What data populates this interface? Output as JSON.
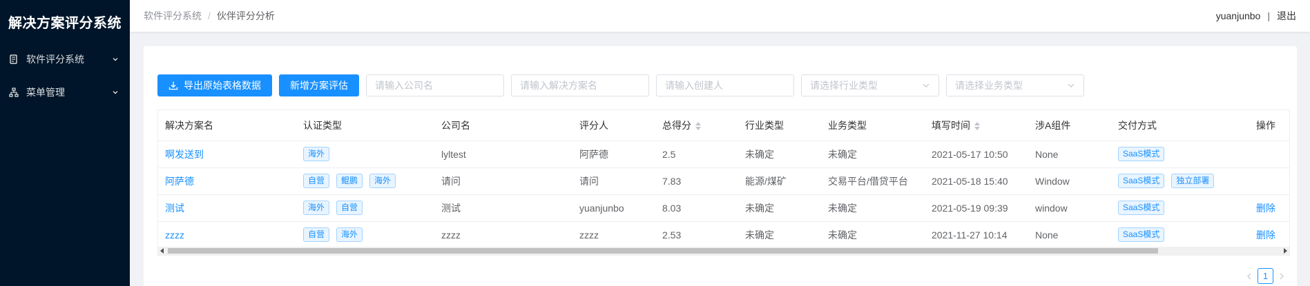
{
  "app": {
    "title": "解决方案评分系统"
  },
  "sidebar": {
    "items": [
      {
        "label": "软件评分系统",
        "icon": "document-icon"
      },
      {
        "label": "菜单管理",
        "icon": "sitemap-icon"
      }
    ]
  },
  "header": {
    "breadcrumb": [
      "软件评分系统",
      "伙伴评分分析"
    ],
    "separator": "/",
    "user": "yuanjunbo",
    "divider": "|",
    "logout": "退出"
  },
  "toolbar": {
    "export_label": "导出原始表格数据",
    "add_label": "新增方案评估",
    "company_placeholder": "请输入公司名",
    "solution_placeholder": "请输入解决方案名",
    "creator_placeholder": "请输入创建人",
    "industry_placeholder": "请选择行业类型",
    "business_placeholder": "请选择业务类型"
  },
  "table": {
    "columns": [
      "解决方案名",
      "认证类型",
      "公司名",
      "评分人",
      "总得分",
      "行业类型",
      "业务类型",
      "填写时间",
      "涉A组件",
      "交付方式",
      "操作"
    ],
    "rows": [
      {
        "name": "啊发送到",
        "cert": [
          "海外"
        ],
        "company": "lyltest",
        "rater": "阿萨德",
        "score": "2.5",
        "industry": "未确定",
        "business": "未确定",
        "time": "2021-05-17 10:50",
        "component": "None",
        "delivery": [
          "SaaS模式"
        ],
        "action": ""
      },
      {
        "name": "阿萨德",
        "cert": [
          "自营",
          "鲲鹏",
          "海外"
        ],
        "company": "请问",
        "rater": "请问",
        "score": "7.83",
        "industry": "能源/煤矿",
        "business": "交易平台/借贷平台",
        "time": "2021-05-18 15:40",
        "component": "Window",
        "delivery": [
          "SaaS模式",
          "独立部署"
        ],
        "action": ""
      },
      {
        "name": "测试",
        "cert": [
          "海外",
          "自营"
        ],
        "company": "测试",
        "rater": "yuanjunbo",
        "score": "8.03",
        "industry": "未确定",
        "business": "未确定",
        "time": "2021-05-19 09:39",
        "component": "window",
        "delivery": [
          "SaaS模式"
        ],
        "action": "删除"
      },
      {
        "name": "zzzz",
        "cert": [
          "自营",
          "海外"
        ],
        "company": "zzzz",
        "rater": "zzzz",
        "score": "2.53",
        "industry": "未确定",
        "business": "未确定",
        "time": "2021-11-27 10:14",
        "component": "None",
        "delivery": [
          "SaaS模式"
        ],
        "action": "删除"
      }
    ]
  },
  "pagination": {
    "current": "1"
  },
  "colors": {
    "primary": "#1890ff",
    "sidebar_bg": "#001529",
    "page_bg": "#f0f2f5",
    "tag_bg": "#e8f4ff",
    "tag_border": "#a3d3ff"
  }
}
